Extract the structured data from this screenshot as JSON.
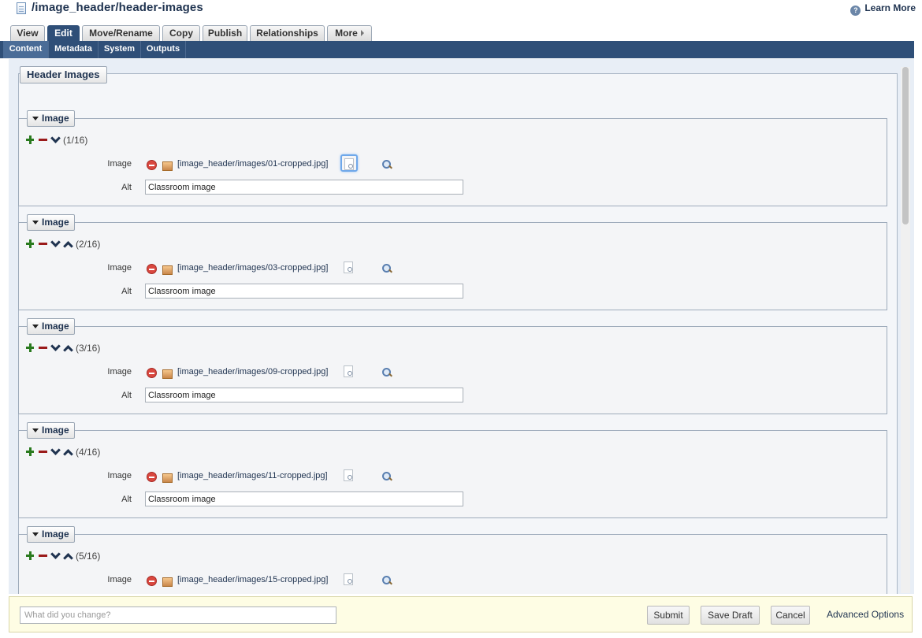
{
  "header": {
    "title": "/image_header/header-images",
    "learn_more": "Learn More"
  },
  "tabs": [
    {
      "label": "View",
      "active": false
    },
    {
      "label": "Edit",
      "active": true
    },
    {
      "label": "Move/Rename",
      "active": false
    },
    {
      "label": "Copy",
      "active": false
    },
    {
      "label": "Publish",
      "active": false
    },
    {
      "label": "Relationships",
      "active": false
    },
    {
      "label": "More",
      "active": false
    }
  ],
  "subtabs": [
    {
      "label": "Content",
      "active": true
    },
    {
      "label": "Metadata",
      "active": false
    },
    {
      "label": "System",
      "active": false
    },
    {
      "label": "Outputs",
      "active": false
    }
  ],
  "form": {
    "section_title": "Header Images",
    "group_label": "Image",
    "image_label": "Image",
    "alt_label": "Alt",
    "groups": [
      {
        "count": "(1/16)",
        "path": "[image_header/images/01-cropped.jpg]",
        "alt": "Classroom image"
      },
      {
        "count": "(2/16)",
        "path": "[image_header/images/03-cropped.jpg]",
        "alt": "Classroom image"
      },
      {
        "count": "(3/16)",
        "path": "[image_header/images/09-cropped.jpg]",
        "alt": "Classroom image"
      },
      {
        "count": "(4/16)",
        "path": "[image_header/images/11-cropped.jpg]",
        "alt": "Classroom image"
      },
      {
        "count": "(5/16)",
        "path": "[image_header/images/15-cropped.jpg]",
        "alt": "Classroom image"
      }
    ]
  },
  "footer": {
    "change_placeholder": "What did you change?",
    "submit": "Submit",
    "save_draft": "Save Draft",
    "cancel": "Cancel",
    "advanced": "Advanced Options"
  }
}
